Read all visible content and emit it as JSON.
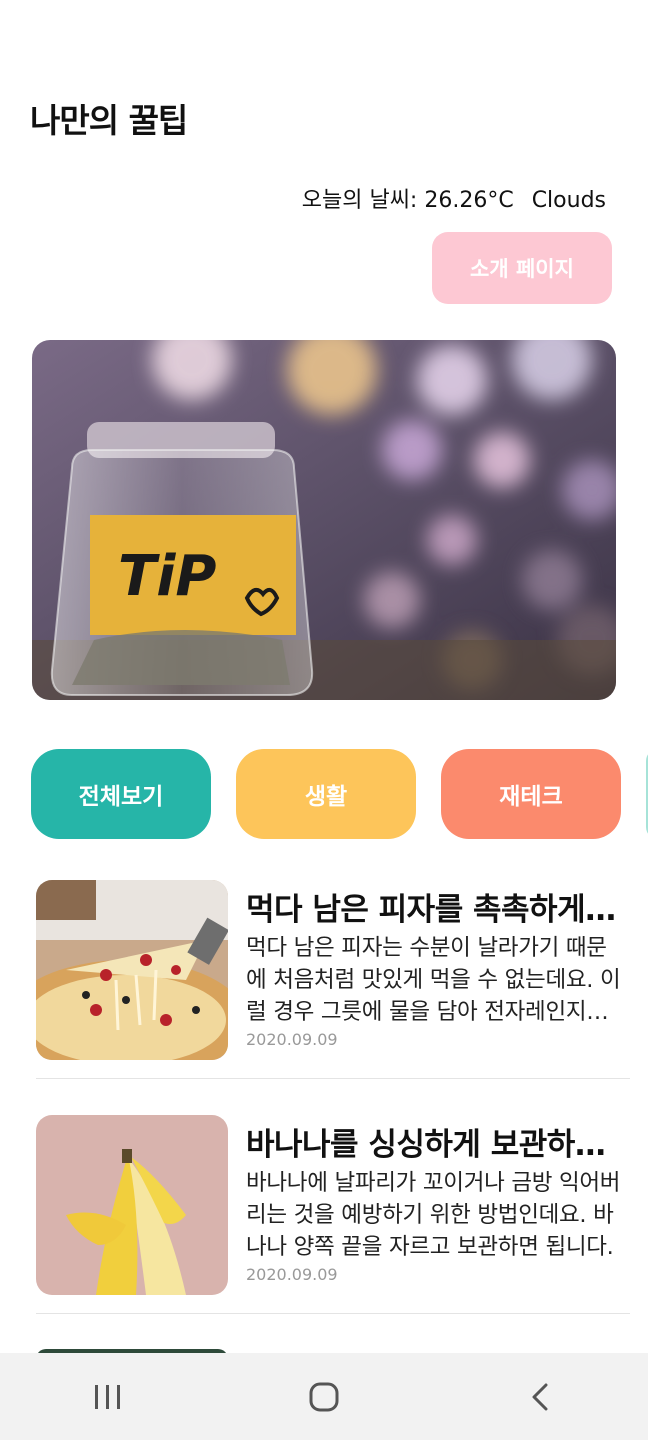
{
  "header": {
    "title": "나만의 꿀팁",
    "weather_label": "오늘의 날씨:",
    "temperature": "26.26°C",
    "condition": "Clouds",
    "about_button": "소개 페이지"
  },
  "hero": {
    "jar_label": "TiP",
    "icon": "tip-jar-photo"
  },
  "categories": [
    {
      "label": "전체보기",
      "color": "#26b5a8"
    },
    {
      "label": "생활",
      "color": "#fdc55a"
    },
    {
      "label": "재테크",
      "color": "#fb8a6d"
    }
  ],
  "posts": [
    {
      "title": "먹다 남은 피자를 촉촉하게 먹는 방법",
      "desc": "먹다 남은 피자는 수분이 날라가기 때문에 처음처럼 맛있게 먹을 수 없는데요. 이럴 경우 그릇에 물을 담아 전자레인지에 함께 돌리면 됩니다.",
      "date": "2020.09.09",
      "icon": "pizza-photo"
    },
    {
      "title": "바나나를 싱싱하게 보관하는 방법",
      "desc": "바나나에 날파리가 꼬이거나 금방 익어버리는 것을 예방하기 위한 방법인데요. 바나나 양쪽 끝을 자르고 보관하면 됩니다.",
      "date": "2020.09.09",
      "icon": "banana-photo"
    }
  ],
  "colors": {
    "accent_pink": "#fdc8d3",
    "teal": "#26b5a8",
    "yellow": "#fdc55a",
    "coral": "#fb8a6d"
  },
  "navbar": [
    "recent-apps-icon",
    "home-icon",
    "back-icon"
  ]
}
